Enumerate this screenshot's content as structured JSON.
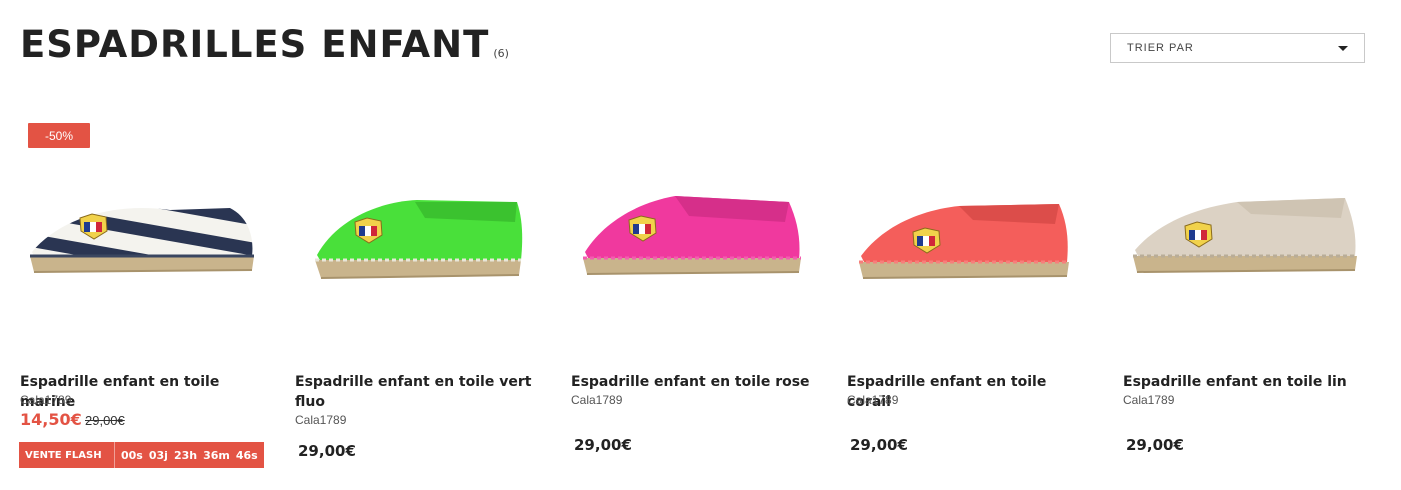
{
  "header": {
    "title": "ESPADRILLES ENFANT",
    "count": "(6)",
    "sort_label": "TRIER PAR"
  },
  "colors": {
    "accent": "#e35344",
    "text": "#222222"
  },
  "products": [
    {
      "name": "Espadrille enfant en toile marine",
      "brand": "Cala1789",
      "badge": "-50%",
      "sale_price": "14,50€",
      "old_price": "29,00€",
      "flash_label": "VENTE FLASH",
      "timer": [
        "00s",
        "03j",
        "23h",
        "36m",
        "46s"
      ],
      "shoe_color": "stripes-navy-white"
    },
    {
      "name": "Espadrille enfant en toile vert fluo",
      "brand": "Cala1789",
      "price": "29,00€",
      "shoe_color": "#49e03a"
    },
    {
      "name": "Espadrille enfant en toile rose",
      "brand": "Cala1789",
      "price": "29,00€",
      "shoe_color": "#f0399e"
    },
    {
      "name": "Espadrille enfant en toile corail",
      "brand": "Cala1789",
      "price": "29,00€",
      "shoe_color": "#f45e5b"
    },
    {
      "name": "Espadrille enfant en toile lin",
      "brand": "Cala1789",
      "price": "29,00€",
      "shoe_color": "#dcd2c4"
    }
  ]
}
